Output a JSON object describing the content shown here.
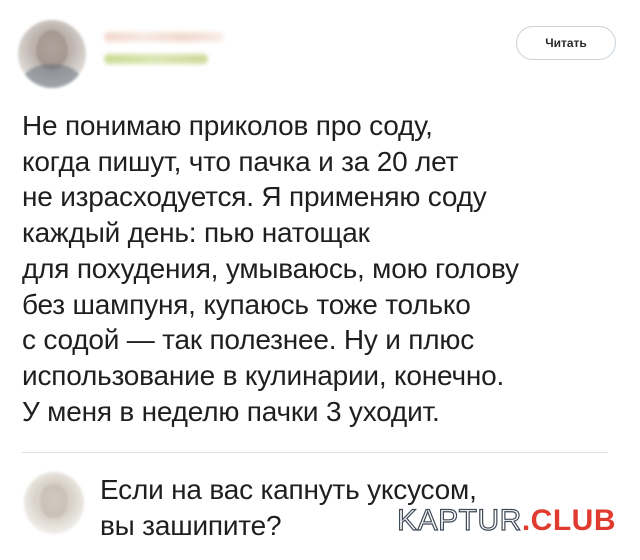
{
  "follow_button": {
    "label": "Читать"
  },
  "post": {
    "lines": [
      "Не понимаю приколов про соду,",
      "когда пишут, что пачка и за 20 лет",
      "не израсходуется. Я применяю соду",
      "каждый день: пью натощак",
      "для похудения, умываюсь, мою голову",
      "без шампуня, купаюсь тоже только",
      "с содой — так полезнее. Ну и плюс",
      "использование в кулинарии, конечно.",
      "У меня в неделю пачки 3 уходит."
    ]
  },
  "reply": {
    "lines": [
      "Если на вас капнуть уксусом,",
      "вы зашипите?"
    ]
  },
  "watermark": {
    "part1": "KAPTUR",
    "part2": ".CLUB"
  },
  "colors": {
    "watermark_accent": "#e03b2f",
    "text": "#1f1f1f"
  }
}
